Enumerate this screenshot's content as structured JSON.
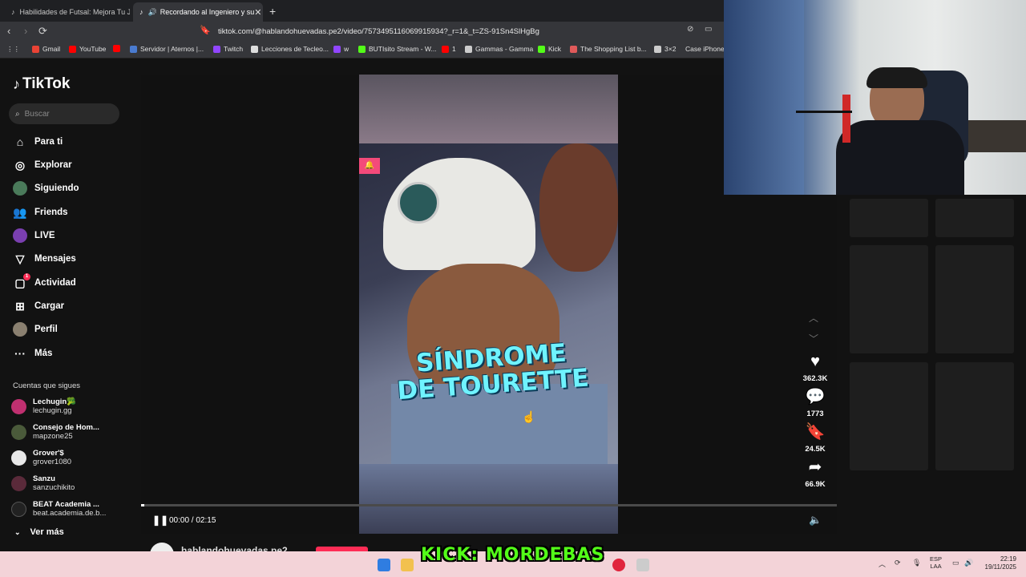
{
  "browser": {
    "tabs": [
      {
        "label": "Habilidades de Futsal: Mejora Tu Jue",
        "active": false
      },
      {
        "label": "Recordando al Ingeniero y su",
        "active": true
      }
    ],
    "url": "tiktok.com/@hablandohuevadas.pe2/video/7573495116069915934?_r=1&_t=ZS-91Sn4SlHgBg",
    "bookmarks": [
      "Gmail",
      "YouTube",
      "",
      "Servidor | Aternos |...",
      "Twitch",
      "Lecciones de Tecleo...",
      "w",
      "BUTIsito Stream - W...",
      "1",
      "Gammas - Gamma",
      "Kick",
      "The Shopping List b...",
      "3×2",
      "Case iPhone..."
    ]
  },
  "sidebar": {
    "logo": "TikTok",
    "search_placeholder": "Buscar",
    "nav": [
      {
        "label": "Para ti",
        "icon": "home-icon"
      },
      {
        "label": "Explorar",
        "icon": "compass-icon"
      },
      {
        "label": "Siguiendo",
        "icon": "following-avatar-icon"
      },
      {
        "label": "Friends",
        "icon": "friends-icon"
      },
      {
        "label": "LIVE",
        "icon": "live-avatar-icon"
      },
      {
        "label": "Mensajes",
        "icon": "messages-icon"
      },
      {
        "label": "Actividad",
        "icon": "activity-icon",
        "badge": "1"
      },
      {
        "label": "Cargar",
        "icon": "upload-icon"
      },
      {
        "label": "Perfil",
        "icon": "profile-avatar-icon"
      },
      {
        "label": "Más",
        "icon": "more-icon"
      }
    ],
    "following_title": "Cuentas que sigues",
    "accounts": [
      {
        "name": "Lechugin🥦",
        "handle": "lechugin.gg"
      },
      {
        "name": "Consejo de Hom...",
        "handle": "mapzone25"
      },
      {
        "name": "Grover'$",
        "handle": "grover1080"
      },
      {
        "name": "Sanzu",
        "handle": "sanzuchikito"
      },
      {
        "name": "BEAT Academia ...",
        "handle": "beat.academia.de.b..."
      }
    ],
    "see_more": "Ver más"
  },
  "video": {
    "overlay_line1": "SÍNDROME",
    "overlay_line2": "DE TOURETTE",
    "time": "00:00 / 02:15",
    "progress": 0.0,
    "author": "hablandohuevadas.pe2"
  },
  "actions": {
    "likes": "362.3K",
    "comments": "1773",
    "saves": "24.5K",
    "shares": "66.9K"
  },
  "stream_overlay": {
    "banner": "KICK: MORDEBAS"
  },
  "taskbar": {
    "lang_top": "ESP",
    "lang_bottom": "LAA",
    "time": "22:19",
    "date": "19/11/2025"
  }
}
